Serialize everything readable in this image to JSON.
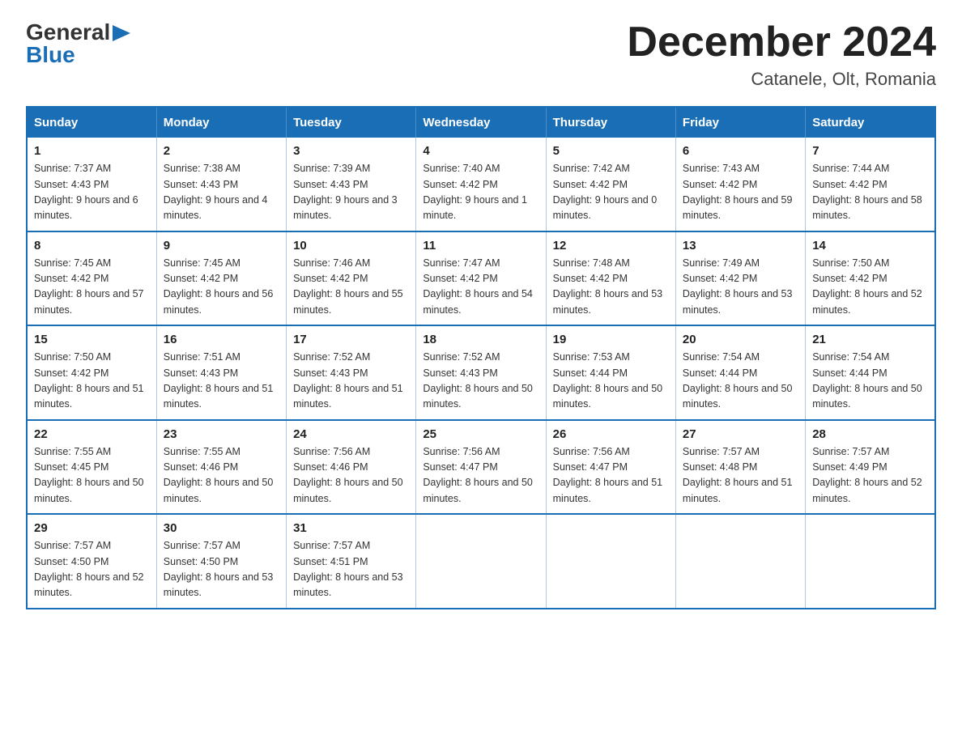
{
  "header": {
    "logo_general": "General",
    "logo_blue": "Blue",
    "month_title": "December 2024",
    "location": "Catanele, Olt, Romania"
  },
  "weekdays": [
    "Sunday",
    "Monday",
    "Tuesday",
    "Wednesday",
    "Thursday",
    "Friday",
    "Saturday"
  ],
  "weeks": [
    [
      {
        "day": "1",
        "sunrise": "Sunrise: 7:37 AM",
        "sunset": "Sunset: 4:43 PM",
        "daylight": "Daylight: 9 hours and 6 minutes."
      },
      {
        "day": "2",
        "sunrise": "Sunrise: 7:38 AM",
        "sunset": "Sunset: 4:43 PM",
        "daylight": "Daylight: 9 hours and 4 minutes."
      },
      {
        "day": "3",
        "sunrise": "Sunrise: 7:39 AM",
        "sunset": "Sunset: 4:43 PM",
        "daylight": "Daylight: 9 hours and 3 minutes."
      },
      {
        "day": "4",
        "sunrise": "Sunrise: 7:40 AM",
        "sunset": "Sunset: 4:42 PM",
        "daylight": "Daylight: 9 hours and 1 minute."
      },
      {
        "day": "5",
        "sunrise": "Sunrise: 7:42 AM",
        "sunset": "Sunset: 4:42 PM",
        "daylight": "Daylight: 9 hours and 0 minutes."
      },
      {
        "day": "6",
        "sunrise": "Sunrise: 7:43 AM",
        "sunset": "Sunset: 4:42 PM",
        "daylight": "Daylight: 8 hours and 59 minutes."
      },
      {
        "day": "7",
        "sunrise": "Sunrise: 7:44 AM",
        "sunset": "Sunset: 4:42 PM",
        "daylight": "Daylight: 8 hours and 58 minutes."
      }
    ],
    [
      {
        "day": "8",
        "sunrise": "Sunrise: 7:45 AM",
        "sunset": "Sunset: 4:42 PM",
        "daylight": "Daylight: 8 hours and 57 minutes."
      },
      {
        "day": "9",
        "sunrise": "Sunrise: 7:45 AM",
        "sunset": "Sunset: 4:42 PM",
        "daylight": "Daylight: 8 hours and 56 minutes."
      },
      {
        "day": "10",
        "sunrise": "Sunrise: 7:46 AM",
        "sunset": "Sunset: 4:42 PM",
        "daylight": "Daylight: 8 hours and 55 minutes."
      },
      {
        "day": "11",
        "sunrise": "Sunrise: 7:47 AM",
        "sunset": "Sunset: 4:42 PM",
        "daylight": "Daylight: 8 hours and 54 minutes."
      },
      {
        "day": "12",
        "sunrise": "Sunrise: 7:48 AM",
        "sunset": "Sunset: 4:42 PM",
        "daylight": "Daylight: 8 hours and 53 minutes."
      },
      {
        "day": "13",
        "sunrise": "Sunrise: 7:49 AM",
        "sunset": "Sunset: 4:42 PM",
        "daylight": "Daylight: 8 hours and 53 minutes."
      },
      {
        "day": "14",
        "sunrise": "Sunrise: 7:50 AM",
        "sunset": "Sunset: 4:42 PM",
        "daylight": "Daylight: 8 hours and 52 minutes."
      }
    ],
    [
      {
        "day": "15",
        "sunrise": "Sunrise: 7:50 AM",
        "sunset": "Sunset: 4:42 PM",
        "daylight": "Daylight: 8 hours and 51 minutes."
      },
      {
        "day": "16",
        "sunrise": "Sunrise: 7:51 AM",
        "sunset": "Sunset: 4:43 PM",
        "daylight": "Daylight: 8 hours and 51 minutes."
      },
      {
        "day": "17",
        "sunrise": "Sunrise: 7:52 AM",
        "sunset": "Sunset: 4:43 PM",
        "daylight": "Daylight: 8 hours and 51 minutes."
      },
      {
        "day": "18",
        "sunrise": "Sunrise: 7:52 AM",
        "sunset": "Sunset: 4:43 PM",
        "daylight": "Daylight: 8 hours and 50 minutes."
      },
      {
        "day": "19",
        "sunrise": "Sunrise: 7:53 AM",
        "sunset": "Sunset: 4:44 PM",
        "daylight": "Daylight: 8 hours and 50 minutes."
      },
      {
        "day": "20",
        "sunrise": "Sunrise: 7:54 AM",
        "sunset": "Sunset: 4:44 PM",
        "daylight": "Daylight: 8 hours and 50 minutes."
      },
      {
        "day": "21",
        "sunrise": "Sunrise: 7:54 AM",
        "sunset": "Sunset: 4:44 PM",
        "daylight": "Daylight: 8 hours and 50 minutes."
      }
    ],
    [
      {
        "day": "22",
        "sunrise": "Sunrise: 7:55 AM",
        "sunset": "Sunset: 4:45 PM",
        "daylight": "Daylight: 8 hours and 50 minutes."
      },
      {
        "day": "23",
        "sunrise": "Sunrise: 7:55 AM",
        "sunset": "Sunset: 4:46 PM",
        "daylight": "Daylight: 8 hours and 50 minutes."
      },
      {
        "day": "24",
        "sunrise": "Sunrise: 7:56 AM",
        "sunset": "Sunset: 4:46 PM",
        "daylight": "Daylight: 8 hours and 50 minutes."
      },
      {
        "day": "25",
        "sunrise": "Sunrise: 7:56 AM",
        "sunset": "Sunset: 4:47 PM",
        "daylight": "Daylight: 8 hours and 50 minutes."
      },
      {
        "day": "26",
        "sunrise": "Sunrise: 7:56 AM",
        "sunset": "Sunset: 4:47 PM",
        "daylight": "Daylight: 8 hours and 51 minutes."
      },
      {
        "day": "27",
        "sunrise": "Sunrise: 7:57 AM",
        "sunset": "Sunset: 4:48 PM",
        "daylight": "Daylight: 8 hours and 51 minutes."
      },
      {
        "day": "28",
        "sunrise": "Sunrise: 7:57 AM",
        "sunset": "Sunset: 4:49 PM",
        "daylight": "Daylight: 8 hours and 52 minutes."
      }
    ],
    [
      {
        "day": "29",
        "sunrise": "Sunrise: 7:57 AM",
        "sunset": "Sunset: 4:50 PM",
        "daylight": "Daylight: 8 hours and 52 minutes."
      },
      {
        "day": "30",
        "sunrise": "Sunrise: 7:57 AM",
        "sunset": "Sunset: 4:50 PM",
        "daylight": "Daylight: 8 hours and 53 minutes."
      },
      {
        "day": "31",
        "sunrise": "Sunrise: 7:57 AM",
        "sunset": "Sunset: 4:51 PM",
        "daylight": "Daylight: 8 hours and 53 minutes."
      },
      null,
      null,
      null,
      null
    ]
  ]
}
